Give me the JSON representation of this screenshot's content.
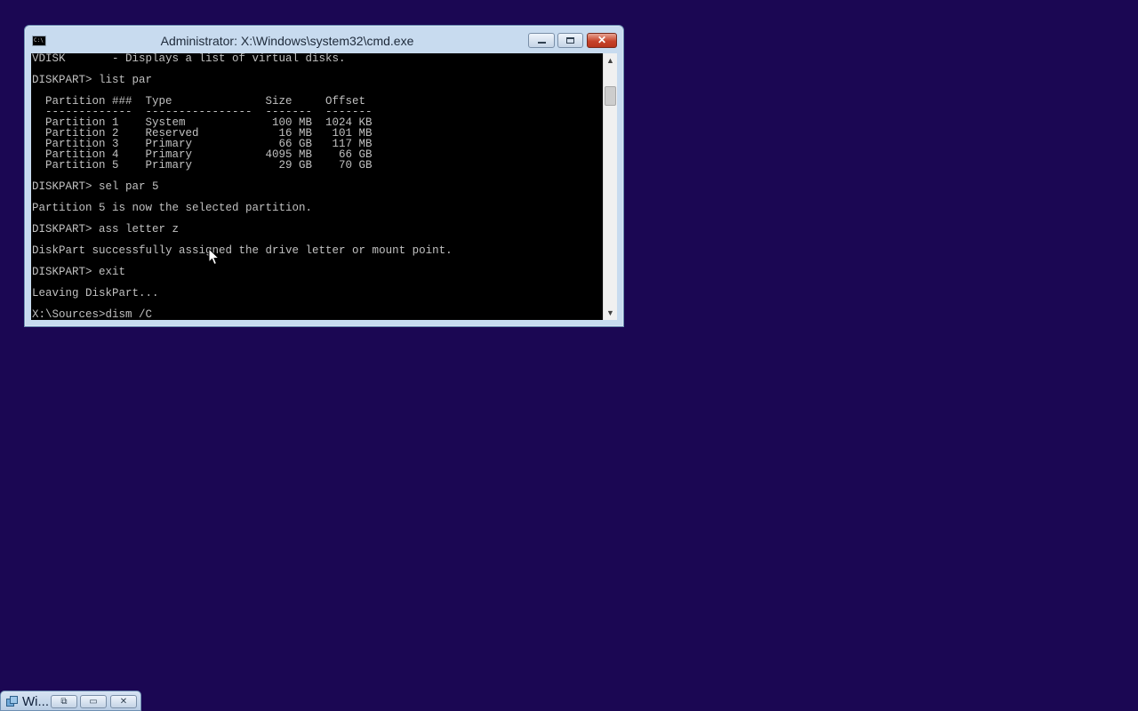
{
  "window": {
    "title": "Administrator: X:\\Windows\\system32\\cmd.exe",
    "icon": "cmd-icon",
    "icon_glyph": "C:\\"
  },
  "console": {
    "lines": [
      "VDISK       - Displays a list of virtual disks.",
      "",
      "DISKPART> list par",
      "",
      "  Partition ###  Type              Size     Offset",
      "  -------------  ----------------  -------  -------",
      "  Partition 1    System             100 MB  1024 KB",
      "  Partition 2    Reserved            16 MB   101 MB",
      "  Partition 3    Primary             66 GB   117 MB",
      "  Partition 4    Primary           4095 MB    66 GB",
      "  Partition 5    Primary             29 GB    70 GB",
      "",
      "DISKPART> sel par 5",
      "",
      "Partition 5 is now the selected partition.",
      "",
      "DISKPART> ass letter z",
      "",
      "DiskPart successfully assigned the drive letter or mount point.",
      "",
      "DISKPART> exit",
      "",
      "Leaving DiskPart...",
      "",
      "X:\\Sources>dism /C"
    ],
    "foreground": "#c0c0c0",
    "background": "#000000"
  },
  "minimized_window": {
    "title": "Wi...",
    "icon": "window-icon"
  },
  "colors": {
    "desktop": "#1b0753",
    "frame": "#c8dbef",
    "close_button": "#c7432a"
  }
}
